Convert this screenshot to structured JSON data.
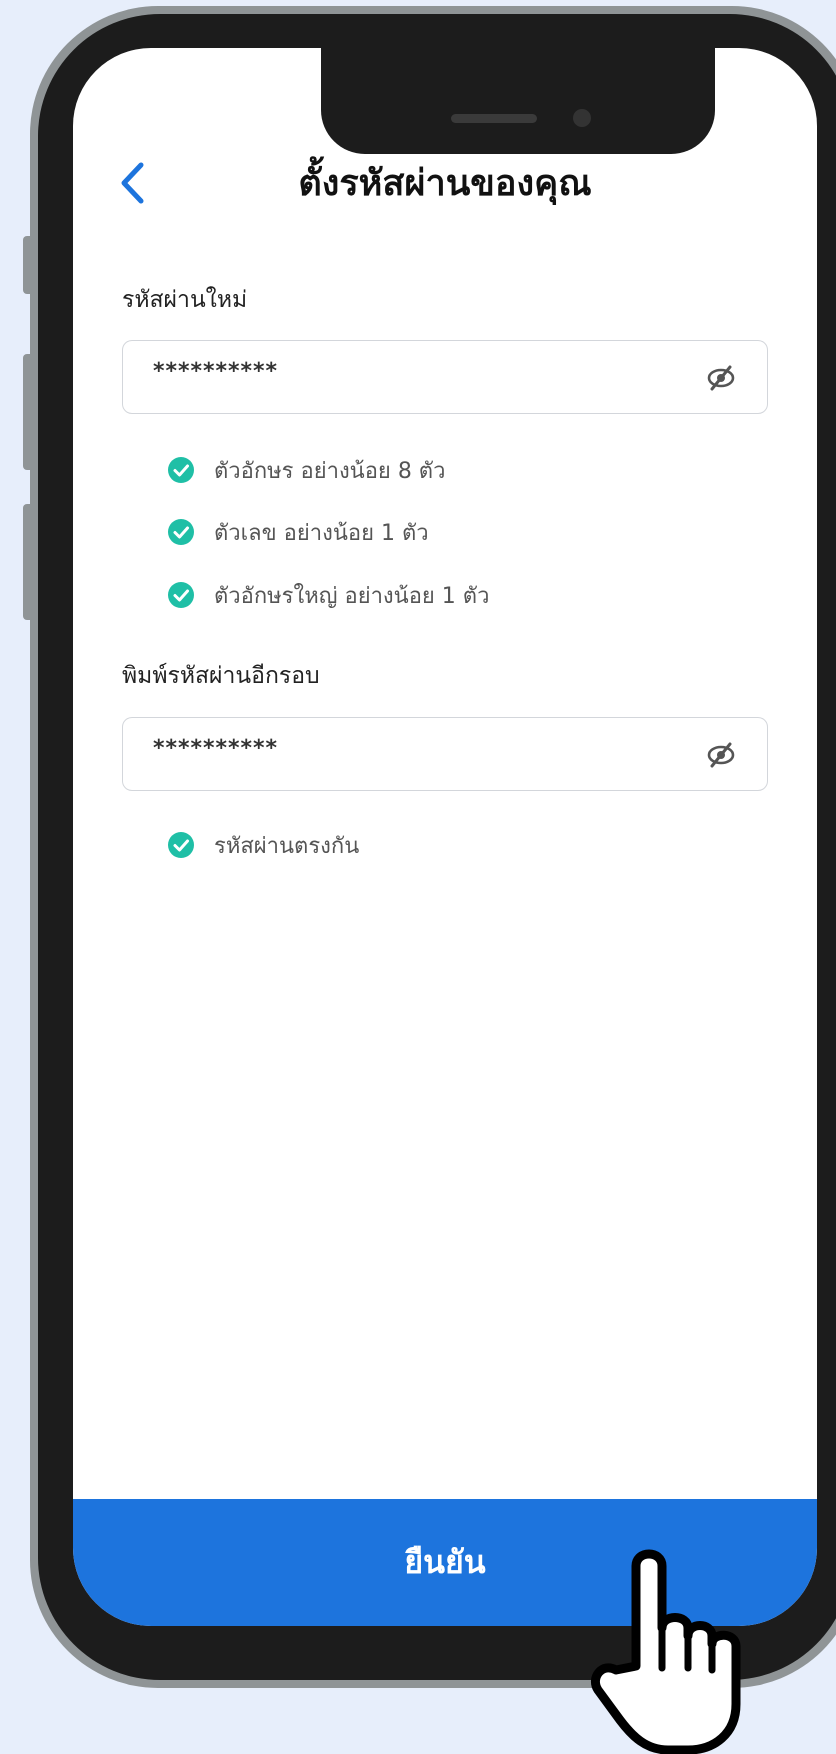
{
  "header": {
    "title": "ตั้งรหัสผ่านของคุณ",
    "back_icon": "chevron-left-icon"
  },
  "new_password": {
    "label": "รหัสผ่านใหม่",
    "value": "**********",
    "toggle_icon": "eye-off-icon"
  },
  "password_rules": [
    {
      "text": "ตัวอักษร อย่างน้อย 8 ตัว",
      "met": true
    },
    {
      "text": "ตัวเลข อย่างน้อย 1 ตัว",
      "met": true
    },
    {
      "text": "ตัวอักษรใหญ่ อย่างน้อย 1 ตัว",
      "met": true
    }
  ],
  "confirm_password": {
    "label": "พิมพ์รหัสผ่านอีกรอบ",
    "value": "**********",
    "toggle_icon": "eye-off-icon",
    "match_rule": {
      "text": "รหัสผ่านตรงกัน",
      "met": true
    }
  },
  "confirm_button": {
    "label": "ยืนยัน"
  },
  "colors": {
    "accent": "#1d74dd",
    "check": "#1fbfa6",
    "background": "#e7eefb"
  }
}
